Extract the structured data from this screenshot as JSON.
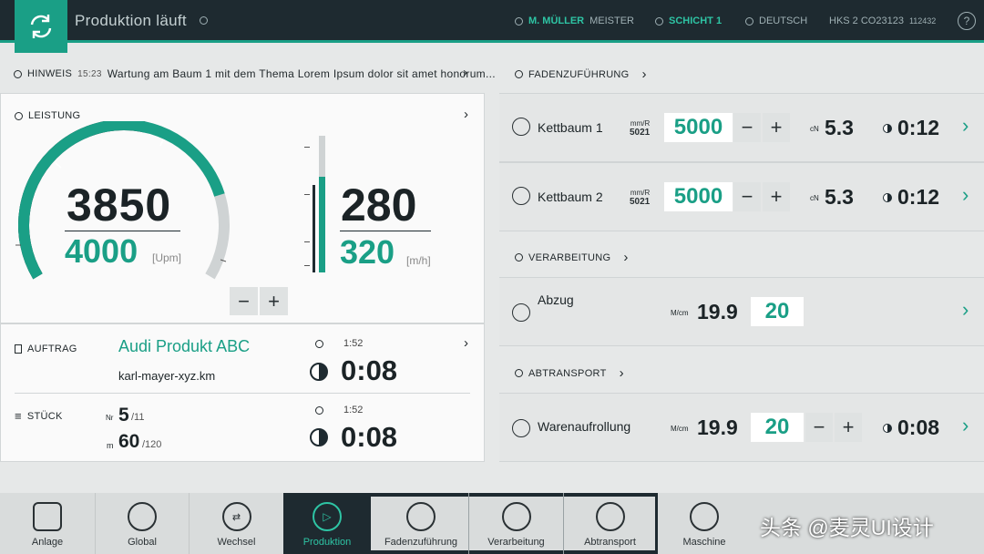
{
  "header": {
    "title": "Produktion läuft",
    "user_name": "M. MÜLLER",
    "user_role": "MEISTER",
    "shift": "SCHICHT 1",
    "language": "DEUTSCH",
    "machine": "HKS 2 CO23123",
    "machine_sub": "112432",
    "help": "?"
  },
  "notice": {
    "label": "HINWEIS",
    "time": "15:23",
    "text": "Wartung am  Baum 1 mit dem Thema Lorem Ipsum dolor sit amet honorum..."
  },
  "leistung": {
    "label": "LEISTUNG",
    "speed_actual": "3850",
    "speed_target": "4000",
    "speed_unit": "[Upm]",
    "speed_fraction": 0.8,
    "prod_actual": "280",
    "prod_target": "320",
    "prod_unit": "[m/h]",
    "prod_fraction": 0.7,
    "minus": "−",
    "plus": "+"
  },
  "auftrag": {
    "label": "AUFTRAG",
    "product": "Audi Produkt ABC",
    "file": "karl-mayer-xyz.km",
    "time_small": "1:52",
    "time_big": "0:08"
  },
  "stueck": {
    "label": "STÜCK",
    "nr_label": "Nr",
    "nr_value": "5",
    "nr_total": "/11",
    "m_label": "m",
    "m_value": "60",
    "m_total": "/120",
    "time_small": "1:52",
    "time_big": "0:08"
  },
  "faden": {
    "label": "FADENZUFÜHRUNG",
    "rows": [
      {
        "name": "Kettbaum 1",
        "unit_top": "mm/R",
        "unit_val": "5021",
        "value": "5000",
        "cn_label": "cN",
        "cn": "5.3",
        "time": "0:12"
      },
      {
        "name": "Kettbaum 2",
        "unit_top": "mm/R",
        "unit_val": "5021",
        "value": "5000",
        "cn_label": "cN",
        "cn": "5.3",
        "time": "0:12"
      }
    ]
  },
  "verarbeitung": {
    "label": "VERARBEITUNG",
    "name": "Abzug",
    "unit": "M/cm",
    "actual": "19.9",
    "target": "20"
  },
  "abtransport": {
    "label": "ABTRANSPORT",
    "name": "Warenaufrollung",
    "unit": "M/cm",
    "actual": "19.9",
    "target": "20",
    "time": "0:08"
  },
  "nav": {
    "items": [
      "Anlage",
      "Global",
      "Wechsel",
      "Produktion",
      "Fadenzuführung",
      "Verarbeitung",
      "Abtransport",
      "Maschine"
    ]
  },
  "watermark": "头条 @麦灵UI设计",
  "colors": {
    "accent": "#1a9f86",
    "header": "#1e2a30"
  }
}
